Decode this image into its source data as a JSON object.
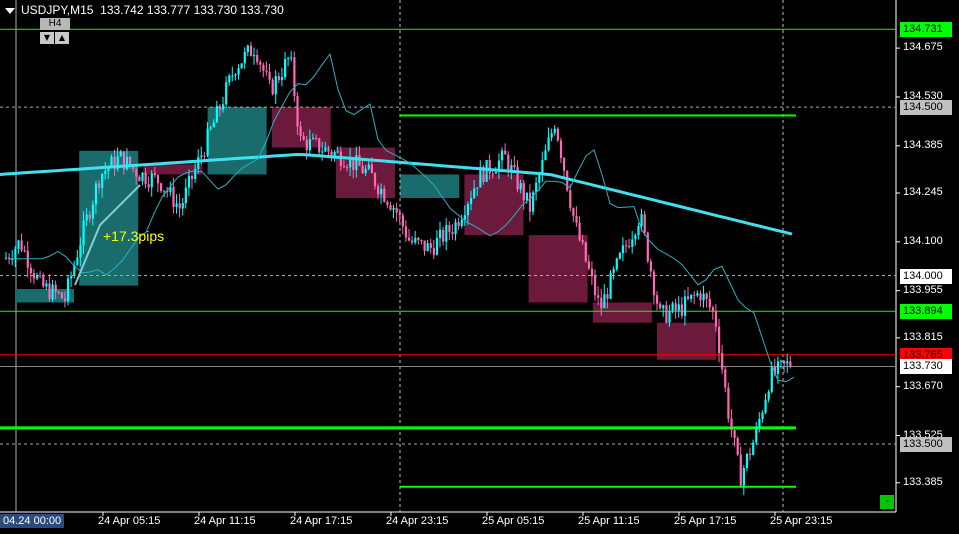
{
  "header": {
    "symbol": "USDJPY,M15",
    "open": "133.742",
    "high": "133.777",
    "low": "133.730",
    "close": "133.730"
  },
  "timeframe_box": "H4",
  "nav_arrows": [
    "▼",
    "▲"
  ],
  "annotation": "+17.3pips",
  "price_scale": {
    "min": 133.31,
    "max": 134.8
  },
  "price_ticks": [
    "134.675",
    "134.530",
    "134.385",
    "134.245",
    "134.100",
    "133.955",
    "133.815",
    "133.670",
    "133.525",
    "133.385"
  ],
  "price_labels": [
    {
      "price": 134.731,
      "text": "134.731",
      "style": "green"
    },
    {
      "price": 134.5,
      "text": "134.500",
      "style": "gray"
    },
    {
      "price": 134.0,
      "text": "134.000",
      "style": "white"
    },
    {
      "price": 133.894,
      "text": "133.894",
      "style": "green"
    },
    {
      "price": 133.765,
      "text": "133.765",
      "style": "red"
    },
    {
      "price": 133.73,
      "text": "133.730",
      "style": "white"
    },
    {
      "price": 133.5,
      "text": "133.500",
      "style": "gray"
    }
  ],
  "first_time": "04.24 00:00",
  "time_labels": [
    "24 Apr 05:15",
    "24 Apr 11:15",
    "24 Apr 17:15",
    "24 Apr 23:15",
    "25 Apr 05:15",
    "25 Apr 11:15",
    "25 Apr 17:15",
    "25 Apr 23:15"
  ],
  "minimize_label": "-",
  "colors": {
    "bull": "#00ffff",
    "bear": "#ff69b4",
    "bull_box": "#1a6b6b",
    "bear_box": "#6b1a3c",
    "level": "#00ff00",
    "ma": "#40e0f0"
  },
  "h4_boxes": [
    {
      "from": 0,
      "to": 2,
      "open": 133.92,
      "close": 133.96,
      "bull": true
    },
    {
      "from": 3,
      "to": 5,
      "open": 133.97,
      "close": 134.37,
      "bull": true
    },
    {
      "from": 6,
      "to": 8,
      "open": 134.33,
      "close": 134.3,
      "bull": false
    },
    {
      "from": 9,
      "to": 11,
      "open": 134.3,
      "close": 134.5,
      "bull": true
    },
    {
      "from": 12,
      "to": 14,
      "open": 134.5,
      "close": 134.38,
      "bull": false
    },
    {
      "from": 15,
      "to": 17,
      "open": 134.38,
      "close": 134.23,
      "bull": false
    },
    {
      "from": 18,
      "to": 20,
      "open": 134.23,
      "close": 134.3,
      "bull": true
    },
    {
      "from": 21,
      "to": 23,
      "open": 134.3,
      "close": 134.12,
      "bull": false
    },
    {
      "from": 24,
      "to": 26,
      "open": 134.12,
      "close": 133.92,
      "bull": false
    },
    {
      "from": 27,
      "to": 29,
      "open": 133.92,
      "close": 133.86,
      "bull": false
    },
    {
      "from": 30,
      "to": 32,
      "open": 133.86,
      "close": 133.75,
      "bull": false
    }
  ]
}
